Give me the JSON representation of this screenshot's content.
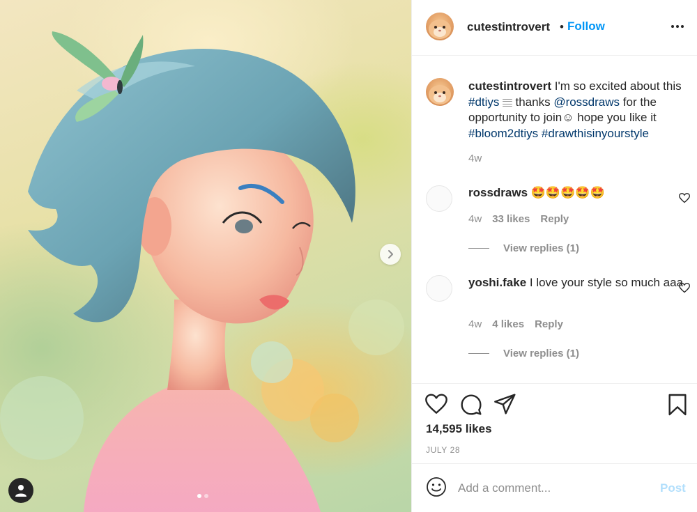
{
  "post": {
    "author": "cutestintrovert",
    "separator": "•",
    "follow_label": "Follow",
    "slides_total": 2,
    "active_slide": 1
  },
  "caption": {
    "username": "cutestintrovert",
    "text_1": " I'm so excited about this ",
    "hashtag_1": "#dtiys",
    "emoji_1": "𝄙",
    "text_2": " thanks ",
    "mention": "@rossdraws",
    "text_3": " for the opportunity to join",
    "emoji_2": "☺",
    "text_4": " hope you like it ",
    "hashtag_2": "#bloom2dtiys",
    "hashtag_3": "#drawthisinyourstyle",
    "time": "4w"
  },
  "comments": [
    {
      "username": "rossdraws",
      "text": " 🤩🤩🤩🤩🤩",
      "time": "4w",
      "likes": "33 likes",
      "reply_label": "Reply",
      "view_replies": "View replies (1)"
    },
    {
      "username": "yoshi.fake",
      "text": " I love your style so much aaa",
      "time": "4w",
      "likes": "4 likes",
      "reply_label": "Reply",
      "view_replies": "View replies (1)"
    }
  ],
  "stats": {
    "likes": "14,595 likes",
    "date": "JULY 28"
  },
  "composer": {
    "placeholder": "Add a comment...",
    "post_label": "Post"
  },
  "icons": {
    "next": "chevron-right-icon",
    "user_tag": "user-icon",
    "more": "more-horizontal-icon",
    "like": "heart-icon",
    "comment": "comment-bubble-icon",
    "share": "paper-plane-icon",
    "save": "bookmark-icon",
    "emoji": "smiley-icon"
  },
  "colors": {
    "accent": "#0095f6",
    "link": "#00376b",
    "muted": "#8e8e8e",
    "post_disabled": "#b2dffc"
  }
}
